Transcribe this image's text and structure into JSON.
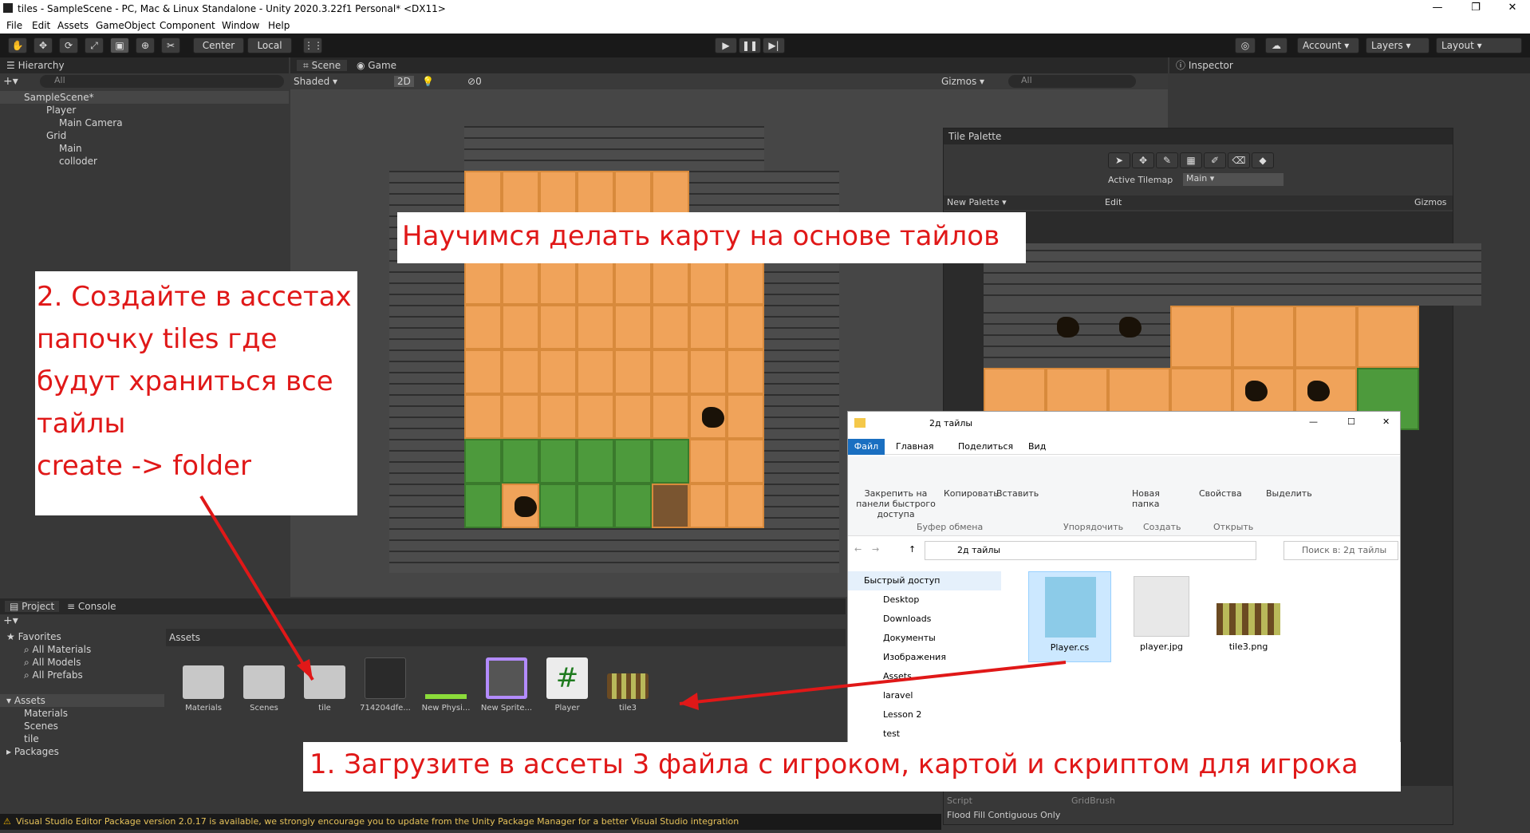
{
  "window": {
    "title": "tiles - SampleScene - PC, Mac & Linux Standalone - Unity 2020.3.22f1 Personal* <DX11>"
  },
  "menu": [
    "File",
    "Edit",
    "Assets",
    "GameObject",
    "Component",
    "Window",
    "Help"
  ],
  "toolbar": {
    "center": "Center",
    "local": "Local",
    "account": "Account",
    "layers": "Layers",
    "layout": "Layout"
  },
  "hierarchy": {
    "title": "Hierarchy",
    "search": "All",
    "items": [
      {
        "label": "SampleScene*"
      },
      {
        "label": "Player"
      },
      {
        "label": "Main Camera"
      },
      {
        "label": "Grid"
      },
      {
        "label": "Main"
      },
      {
        "label": "colloder"
      }
    ]
  },
  "scene": {
    "tab_scene": "Scene",
    "tab_game": "Game",
    "shading": "Shaded",
    "mode2d": "2D",
    "zero": "0",
    "gizmos": "Gizmos",
    "search": "All"
  },
  "inspector": {
    "title": "Inspector"
  },
  "tile_palette": {
    "title": "Tile Palette",
    "active_tilemap_label": "Active Tilemap",
    "active_tilemap": "Main",
    "palette": "New Palette",
    "edit": "Edit",
    "gizmos": "Gizmos",
    "script_label": "Script",
    "script_value": "GridBrush",
    "flood": "Flood Fill Contiguous Only"
  },
  "project": {
    "tab_project": "Project",
    "tab_console": "Console",
    "favorites": "Favorites",
    "fav_items": [
      "All Materials",
      "All Models",
      "All Prefabs"
    ],
    "assets": "Assets",
    "asset_folders": [
      "Materials",
      "Scenes",
      "tile"
    ],
    "packages": "Packages",
    "breadcrumb": "Assets",
    "grid": [
      {
        "label": "Materials"
      },
      {
        "label": "Scenes"
      },
      {
        "label": "tile"
      },
      {
        "label": "714204dfe..."
      },
      {
        "label": "New Physi..."
      },
      {
        "label": "New Sprite..."
      },
      {
        "label": "Player"
      },
      {
        "label": "tile3"
      }
    ]
  },
  "status": {
    "text": "Visual Studio Editor Package version 2.0.17 is available, we strongly encourage you to update from the Unity Package Manager for a better Visual Studio integration"
  },
  "annotations": {
    "top": "Научимся делать карту на основе тайлов",
    "left": [
      "2. Создайте в ассетах",
      "папочку tiles где",
      "будут храниться все",
      "тайлы",
      "create -> folder"
    ],
    "bottom": "1. Загрузите в ассеты 3 файла с игроком, картой и скриптом для игрока"
  },
  "explorer": {
    "title": "2д тайлы",
    "tabs": [
      "Файл",
      "Главная",
      "Поделиться",
      "Вид"
    ],
    "ribbon": {
      "pin": "Закрепить на панели быстрого доступа",
      "copy": "Копировать",
      "paste": "Вставить",
      "clipboard": "Буфер обмена",
      "organize": "Упорядочить",
      "new_folder": "Новая папка",
      "create": "Создать",
      "props": "Свойства",
      "open": "Открыть",
      "select": "Выделить"
    },
    "path": "2д тайлы",
    "search": "Поиск в: 2д тайлы",
    "nav": [
      "Быстрый доступ",
      "Desktop",
      "Downloads",
      "Документы",
      "Изображения",
      "Assets",
      "laravel",
      "Lesson 2",
      "test"
    ],
    "files": [
      {
        "name": "Player.cs"
      },
      {
        "name": "player.jpg"
      },
      {
        "name": "tile3.png"
      }
    ]
  }
}
